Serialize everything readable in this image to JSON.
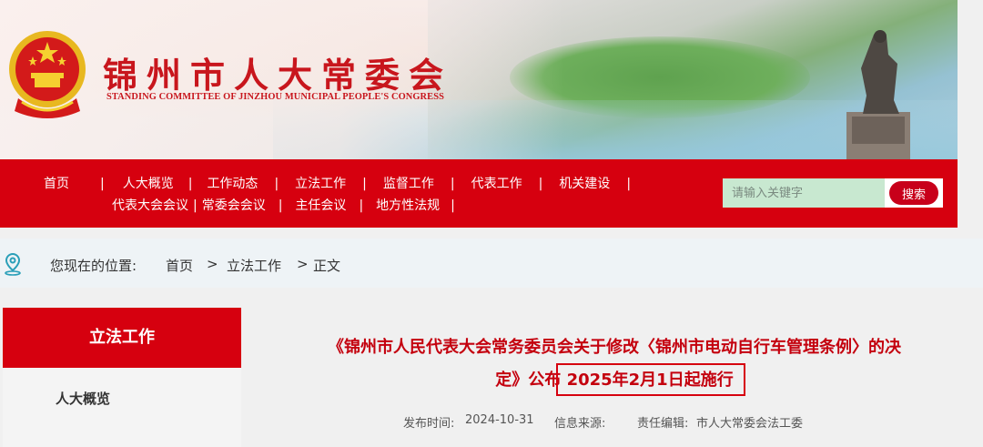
{
  "header": {
    "site_title": "锦州市人大常委会",
    "site_subtitle": "STANDING COMMITTEE OF JINZHOU MUNICIPAL PEOPLE'S CONGRESS"
  },
  "nav": {
    "row1": [
      "首页",
      "人大概览",
      "工作动态",
      "立法工作",
      "监督工作",
      "代表工作",
      "机关建设"
    ],
    "row2": [
      "代表大会会议",
      "常委会会议",
      "主任会议",
      "地方性法规"
    ]
  },
  "search": {
    "placeholder": "请输入关键字",
    "button": "搜索"
  },
  "breadcrumb": {
    "label": "您现在的位置:",
    "home": "首页",
    "sep1": ">",
    "section": "立法工作",
    "sep2": ">",
    "current": "正文"
  },
  "sidebar": {
    "heading": "立法工作",
    "items": [
      "人大概览"
    ]
  },
  "article": {
    "title_line1": "《锦州市人民代表大会常务委员会关于修改〈锦州市电动自行车管理条例〉的决",
    "title_line2_a": "定》公布 ",
    "title_line2_b": "2025年2月1日起施行",
    "publish_label": "发布时间:",
    "publish_date": "2024-10-31",
    "source_label": "信息来源:",
    "editor_label": "责任编辑:",
    "editor": "市人大常委会法工委"
  },
  "colors": {
    "brand_red": "#d6000f",
    "title_red": "#c4000e"
  }
}
